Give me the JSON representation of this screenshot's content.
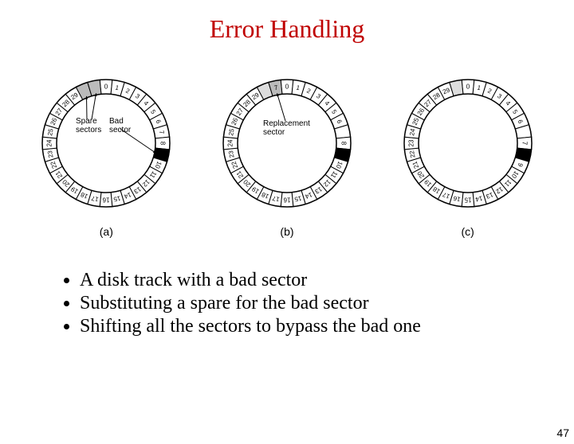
{
  "title": "Error Handling",
  "bullets": [
    "A disk track with a bad sector",
    "Substituting a spare for the bad sector",
    "Shifting all the sectors to bypass the bad one"
  ],
  "disk_a": {
    "caption": "(a)",
    "label_spare": "Spare\nsectors",
    "label_bad": "Bad\nsector",
    "bad_index": 9,
    "spare_fill": [
      30,
      31
    ],
    "sectors": [
      "0",
      "1",
      "2",
      "3",
      "4",
      "5",
      "6",
      "7",
      "8",
      "9",
      "10",
      "11",
      "12",
      "13",
      "14",
      "15",
      "16",
      "17",
      "18",
      "19",
      "20",
      "21",
      "22",
      "23",
      "24",
      "25",
      "26",
      "27",
      "28",
      "29",
      "",
      ""
    ]
  },
  "disk_b": {
    "caption": "(b)",
    "label_repl": "Replacement\nsector",
    "bad_index": 9,
    "repl_fill": 31,
    "sectors": [
      "0",
      "1",
      "2",
      "3",
      "4",
      "5",
      "6",
      "",
      "8",
      "9",
      "10",
      "11",
      "12",
      "13",
      "14",
      "15",
      "16",
      "17",
      "18",
      "19",
      "20",
      "21",
      "22",
      "23",
      "24",
      "25",
      "26",
      "27",
      "28",
      "29",
      "",
      "7"
    ]
  },
  "disk_c": {
    "caption": "(c)",
    "bad_index": 9,
    "sectors": [
      "0",
      "1",
      "2",
      "3",
      "4",
      "5",
      "6",
      "",
      "7",
      "8",
      "9",
      "10",
      "11",
      "12",
      "13",
      "14",
      "15",
      "16",
      "17",
      "18",
      "19",
      "20",
      "21",
      "22",
      "23",
      "24",
      "25",
      "26",
      "27",
      "28",
      "29",
      ""
    ]
  },
  "page_number": "47"
}
